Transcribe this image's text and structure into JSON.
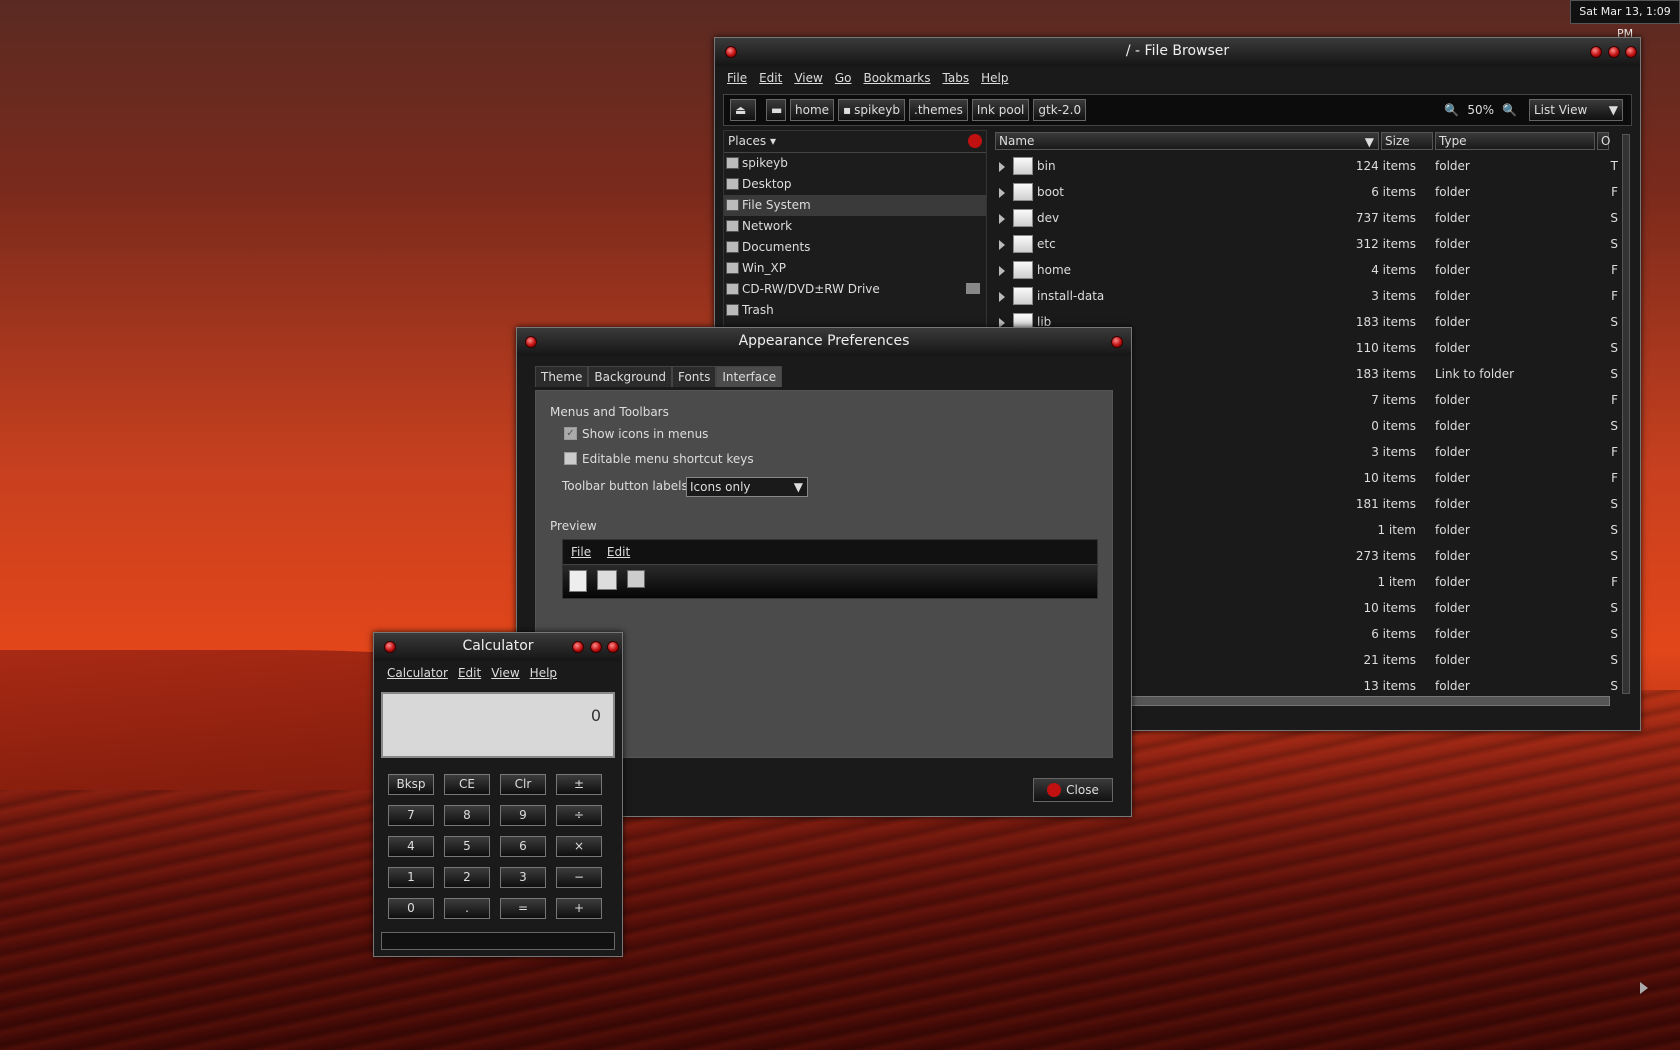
{
  "clock": "Sat Mar 13,  1:09 PM",
  "fb": {
    "title": "/ - File Browser",
    "menu": [
      "File",
      "Edit",
      "View",
      "Go",
      "Bookmarks",
      "Tabs",
      "Help"
    ],
    "path": [
      "home",
      "spikeyb",
      ".themes",
      "Ink pool",
      "gtk-2.0"
    ],
    "zoom": "50%",
    "view": "List View",
    "places_label": "Places",
    "places": [
      "spikeyb",
      "Desktop",
      "File System",
      "Network",
      "Documents",
      "Win_XP",
      "CD-RW/DVD±RW Drive",
      "Trash"
    ],
    "cols": {
      "name": "Name",
      "size": "Size",
      "type": "Type",
      "o": "O"
    },
    "rows": [
      {
        "name": "bin",
        "size": "124 items",
        "type": "folder",
        "o": "T"
      },
      {
        "name": "boot",
        "size": "6 items",
        "type": "folder",
        "o": "F"
      },
      {
        "name": "dev",
        "size": "737 items",
        "type": "folder",
        "o": "S"
      },
      {
        "name": "etc",
        "size": "312 items",
        "type": "folder",
        "o": "S"
      },
      {
        "name": "home",
        "size": "4 items",
        "type": "folder",
        "o": "F"
      },
      {
        "name": "install-data",
        "size": "3 items",
        "type": "folder",
        "o": "F"
      },
      {
        "name": "lib",
        "size": "183 items",
        "type": "folder",
        "o": "S"
      },
      {
        "name": "",
        "size": "110 items",
        "type": "folder",
        "o": "S"
      },
      {
        "name": "",
        "size": "183 items",
        "type": "Link to folder",
        "o": "S"
      },
      {
        "name": "",
        "size": "7 items",
        "type": "folder",
        "o": "F"
      },
      {
        "name": "",
        "size": "0 items",
        "type": "folder",
        "o": "S"
      },
      {
        "name": "",
        "size": "3 items",
        "type": "folder",
        "o": "F"
      },
      {
        "name": "",
        "size": "10 items",
        "type": "folder",
        "o": "F"
      },
      {
        "name": "",
        "size": "181 items",
        "type": "folder",
        "o": "S"
      },
      {
        "name": "",
        "size": "1 item",
        "type": "folder",
        "o": "S"
      },
      {
        "name": "",
        "size": "273 items",
        "type": "folder",
        "o": "S"
      },
      {
        "name": "",
        "size": "1 item",
        "type": "folder",
        "o": "F"
      },
      {
        "name": "",
        "size": "10 items",
        "type": "folder",
        "o": "S"
      },
      {
        "name": "",
        "size": "6 items",
        "type": "folder",
        "o": "S"
      },
      {
        "name": "",
        "size": "21 items",
        "type": "folder",
        "o": "S"
      },
      {
        "name": "",
        "size": "13 items",
        "type": "folder",
        "o": "S"
      }
    ]
  },
  "ap": {
    "title": "Appearance Preferences",
    "tabs": [
      "Theme",
      "Background",
      "Fonts",
      "Interface"
    ],
    "section1": "Menus and Toolbars",
    "cb1": "Show icons in menus",
    "cb2": "Editable menu shortcut keys",
    "tbl_label": "Toolbar button labels:",
    "tbl_value": "Icons only",
    "preview": "Preview",
    "pmenu": [
      "File",
      "Edit"
    ],
    "close": "Close"
  },
  "calc": {
    "title": "Calculator",
    "menu": [
      "Calculator",
      "Edit",
      "View",
      "Help"
    ],
    "display": "0",
    "buttons": [
      [
        "Bksp",
        "CE",
        "Clr",
        "±"
      ],
      [
        "7",
        "8",
        "9",
        "÷"
      ],
      [
        "4",
        "5",
        "6",
        "×"
      ],
      [
        "1",
        "2",
        "3",
        "−"
      ],
      [
        "0",
        ".",
        "=",
        "+"
      ]
    ]
  }
}
